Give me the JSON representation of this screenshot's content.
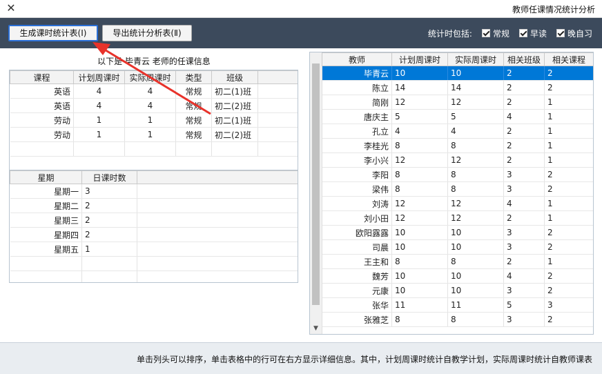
{
  "window": {
    "title": "教师任课情况统计分析",
    "close_glyph": "✕"
  },
  "toolbar": {
    "btn_generate": "生成课时统计表(Ⅰ)",
    "btn_export": "导出统计分析表(Ⅱ)",
    "filter_label": "统计时包括:",
    "filters": [
      "常规",
      "早读",
      "晚自习"
    ]
  },
  "detail": {
    "caption": "以下是 毕青云 老师的任课信息",
    "courses": {
      "headers": [
        "课程",
        "计划周课时",
        "实际周课时",
        "类型",
        "班级"
      ],
      "rows": [
        [
          "英语",
          "4",
          "4",
          "常规",
          "初二(1)班"
        ],
        [
          "英语",
          "4",
          "4",
          "常规",
          "初二(2)班"
        ],
        [
          "劳动",
          "1",
          "1",
          "常规",
          "初二(1)班"
        ],
        [
          "劳动",
          "1",
          "1",
          "常规",
          "初二(2)班"
        ]
      ]
    },
    "daily": {
      "headers": [
        "星期",
        "日课时数"
      ],
      "rows": [
        [
          "星期一",
          "3"
        ],
        [
          "星期二",
          "2"
        ],
        [
          "星期三",
          "2"
        ],
        [
          "星期四",
          "2"
        ],
        [
          "星期五",
          "1"
        ]
      ]
    }
  },
  "teachers": {
    "headers": [
      "教师",
      "计划周课时",
      "实际周课时",
      "相关班级",
      "相关课程"
    ],
    "selected_index": 0,
    "rows": [
      [
        "毕青云",
        "10",
        "10",
        "2",
        "2"
      ],
      [
        "陈立",
        "14",
        "14",
        "2",
        "2"
      ],
      [
        "简刚",
        "12",
        "12",
        "2",
        "1"
      ],
      [
        "唐庆主",
        "5",
        "5",
        "4",
        "1"
      ],
      [
        "孔立",
        "4",
        "4",
        "2",
        "1"
      ],
      [
        "李桂光",
        "8",
        "8",
        "2",
        "1"
      ],
      [
        "李小兴",
        "12",
        "12",
        "2",
        "1"
      ],
      [
        "李阳",
        "8",
        "8",
        "3",
        "2"
      ],
      [
        "梁伟",
        "8",
        "8",
        "3",
        "2"
      ],
      [
        "刘涛",
        "12",
        "12",
        "4",
        "1"
      ],
      [
        "刘小田",
        "12",
        "12",
        "2",
        "1"
      ],
      [
        "欧阳露露",
        "10",
        "10",
        "3",
        "2"
      ],
      [
        "司晨",
        "10",
        "10",
        "3",
        "2"
      ],
      [
        "王主和",
        "8",
        "8",
        "2",
        "1"
      ],
      [
        "魏芳",
        "10",
        "10",
        "4",
        "2"
      ],
      [
        "元康",
        "10",
        "10",
        "3",
        "2"
      ],
      [
        "张华",
        "11",
        "11",
        "5",
        "3"
      ],
      [
        "张雅芝",
        "8",
        "8",
        "3",
        "2"
      ]
    ]
  },
  "status": {
    "text": "单击列头可以排序，单击表格中的行可在右方显示详细信息。其中，计划周课时统计自教学计划，实际周课时统计自教师课表"
  },
  "colors": {
    "toolbar": "#3c4a5c",
    "selection": "#0078d7",
    "arrow": "#e8322a"
  }
}
